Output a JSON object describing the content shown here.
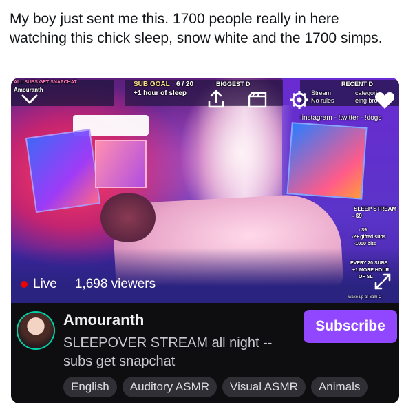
{
  "tweet": {
    "text": "My boy just sent me this. 1700 people really in here watching this chick sleep, snow white and the 1700 simps."
  },
  "stream_overlay": {
    "left_banner_title": "ALL SUBS GET SNAPCHAT",
    "left_banner_name": "Amouranth",
    "sub_goal_label": "SUB GOAL",
    "sub_goal_count": "6 / 20",
    "sub_goal_desc": "+1 hour of sleep",
    "biggest_label": "BIGGEST D",
    "recent_label": "RECENT D",
    "notice_line1": "Stream",
    "notice_line1b": "categori",
    "notice_line2": "No rules",
    "notice_line2b": "eing bro",
    "socials": "!instagram - !twitter - !dogs",
    "sleep_stream_title": "SLEEP STREAM",
    "sleep_stream_sub": "TEXT TO SPEECH",
    "tts_line1": "- $9",
    "tts_line2": "-2+ gifted subs",
    "tts_line3": "-1000 bits",
    "every_line1": "EVERY 20 SUBS",
    "every_line2": "+1 MORE HOUR",
    "every_line3": "OF SL",
    "wake_line": "wake up at 6am C"
  },
  "player": {
    "live_label": "Live",
    "viewers_label": "1,698 viewers",
    "icons": [
      "chevron-down-icon",
      "share-icon",
      "clip-icon",
      "settings-icon",
      "heart-icon",
      "fullscreen-icon"
    ]
  },
  "channel": {
    "name": "Amouranth",
    "stream_title": "SLEEPOVER STREAM all night -- subs get snapchat",
    "subscribe_label": "Subscribe",
    "tags": [
      "English",
      "Auditory ASMR",
      "Visual ASMR",
      "Animals"
    ]
  },
  "colors": {
    "accent": "#9147ff",
    "live": "#eb0400",
    "avatar_ring": "#00d1a6"
  }
}
